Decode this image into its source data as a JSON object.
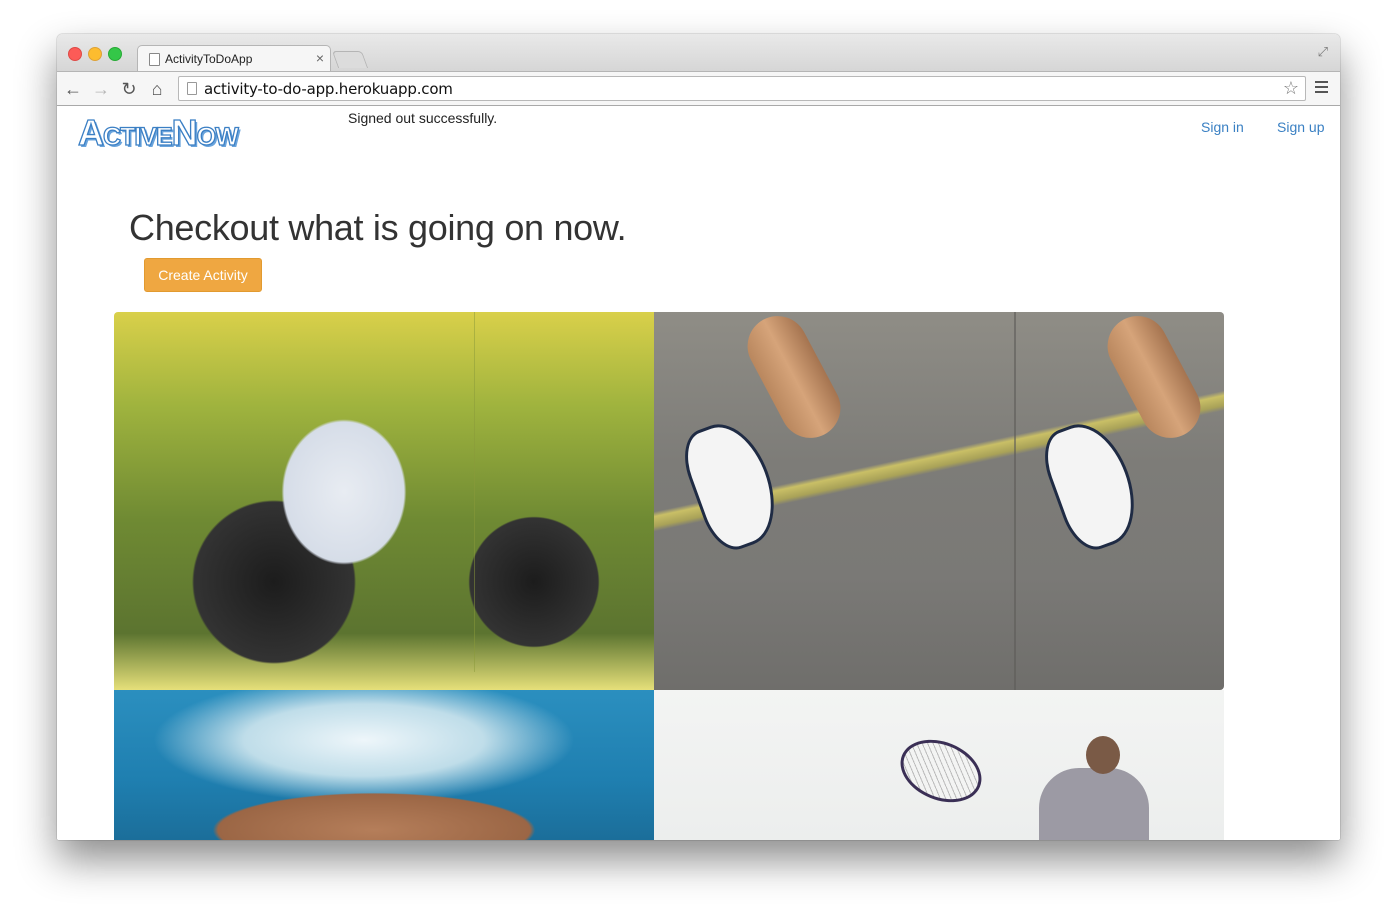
{
  "browser": {
    "tab_title": "ActivityToDoApp",
    "tab_close": "×",
    "url": "activity-to-do-app.herokuapp.com",
    "icons": [
      "back-icon",
      "forward-icon",
      "reload-icon",
      "home-icon",
      "star-icon",
      "menu-icon"
    ]
  },
  "header": {
    "logo": "ActiveNow",
    "flash": "Signed out successfully.",
    "sign_in": "Sign in",
    "sign_up": "Sign up"
  },
  "main": {
    "headline": "Checkout what is going on now.",
    "create_button": "Create Activity"
  },
  "colors": {
    "link": "#3a80c3",
    "button": "#efa741",
    "logo": "#3b7fc4"
  }
}
